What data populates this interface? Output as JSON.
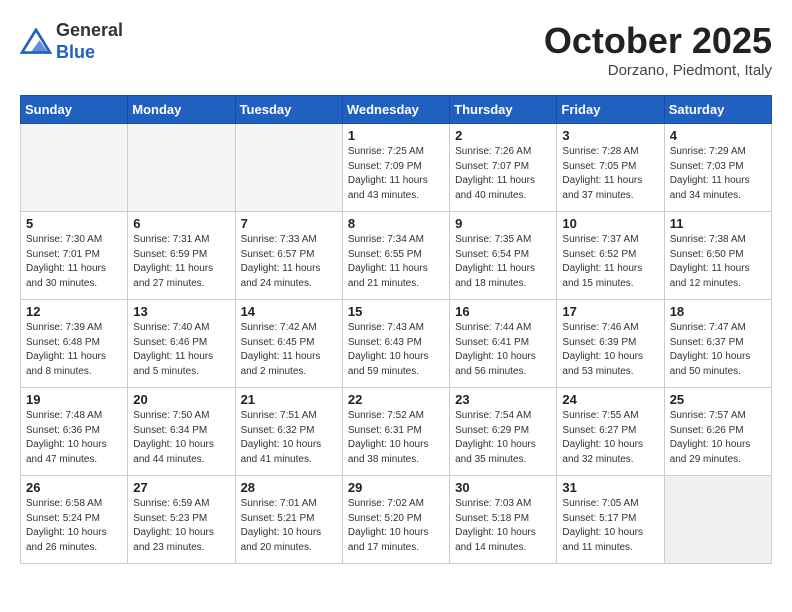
{
  "header": {
    "logo_line1": "General",
    "logo_line2": "Blue",
    "month_title": "October 2025",
    "location": "Dorzano, Piedmont, Italy"
  },
  "days_of_week": [
    "Sunday",
    "Monday",
    "Tuesday",
    "Wednesday",
    "Thursday",
    "Friday",
    "Saturday"
  ],
  "weeks": [
    [
      {
        "day": "",
        "info": ""
      },
      {
        "day": "",
        "info": ""
      },
      {
        "day": "",
        "info": ""
      },
      {
        "day": "1",
        "info": "Sunrise: 7:25 AM\nSunset: 7:09 PM\nDaylight: 11 hours\nand 43 minutes."
      },
      {
        "day": "2",
        "info": "Sunrise: 7:26 AM\nSunset: 7:07 PM\nDaylight: 11 hours\nand 40 minutes."
      },
      {
        "day": "3",
        "info": "Sunrise: 7:28 AM\nSunset: 7:05 PM\nDaylight: 11 hours\nand 37 minutes."
      },
      {
        "day": "4",
        "info": "Sunrise: 7:29 AM\nSunset: 7:03 PM\nDaylight: 11 hours\nand 34 minutes."
      }
    ],
    [
      {
        "day": "5",
        "info": "Sunrise: 7:30 AM\nSunset: 7:01 PM\nDaylight: 11 hours\nand 30 minutes."
      },
      {
        "day": "6",
        "info": "Sunrise: 7:31 AM\nSunset: 6:59 PM\nDaylight: 11 hours\nand 27 minutes."
      },
      {
        "day": "7",
        "info": "Sunrise: 7:33 AM\nSunset: 6:57 PM\nDaylight: 11 hours\nand 24 minutes."
      },
      {
        "day": "8",
        "info": "Sunrise: 7:34 AM\nSunset: 6:55 PM\nDaylight: 11 hours\nand 21 minutes."
      },
      {
        "day": "9",
        "info": "Sunrise: 7:35 AM\nSunset: 6:54 PM\nDaylight: 11 hours\nand 18 minutes."
      },
      {
        "day": "10",
        "info": "Sunrise: 7:37 AM\nSunset: 6:52 PM\nDaylight: 11 hours\nand 15 minutes."
      },
      {
        "day": "11",
        "info": "Sunrise: 7:38 AM\nSunset: 6:50 PM\nDaylight: 11 hours\nand 12 minutes."
      }
    ],
    [
      {
        "day": "12",
        "info": "Sunrise: 7:39 AM\nSunset: 6:48 PM\nDaylight: 11 hours\nand 8 minutes."
      },
      {
        "day": "13",
        "info": "Sunrise: 7:40 AM\nSunset: 6:46 PM\nDaylight: 11 hours\nand 5 minutes."
      },
      {
        "day": "14",
        "info": "Sunrise: 7:42 AM\nSunset: 6:45 PM\nDaylight: 11 hours\nand 2 minutes."
      },
      {
        "day": "15",
        "info": "Sunrise: 7:43 AM\nSunset: 6:43 PM\nDaylight: 10 hours\nand 59 minutes."
      },
      {
        "day": "16",
        "info": "Sunrise: 7:44 AM\nSunset: 6:41 PM\nDaylight: 10 hours\nand 56 minutes."
      },
      {
        "day": "17",
        "info": "Sunrise: 7:46 AM\nSunset: 6:39 PM\nDaylight: 10 hours\nand 53 minutes."
      },
      {
        "day": "18",
        "info": "Sunrise: 7:47 AM\nSunset: 6:37 PM\nDaylight: 10 hours\nand 50 minutes."
      }
    ],
    [
      {
        "day": "19",
        "info": "Sunrise: 7:48 AM\nSunset: 6:36 PM\nDaylight: 10 hours\nand 47 minutes."
      },
      {
        "day": "20",
        "info": "Sunrise: 7:50 AM\nSunset: 6:34 PM\nDaylight: 10 hours\nand 44 minutes."
      },
      {
        "day": "21",
        "info": "Sunrise: 7:51 AM\nSunset: 6:32 PM\nDaylight: 10 hours\nand 41 minutes."
      },
      {
        "day": "22",
        "info": "Sunrise: 7:52 AM\nSunset: 6:31 PM\nDaylight: 10 hours\nand 38 minutes."
      },
      {
        "day": "23",
        "info": "Sunrise: 7:54 AM\nSunset: 6:29 PM\nDaylight: 10 hours\nand 35 minutes."
      },
      {
        "day": "24",
        "info": "Sunrise: 7:55 AM\nSunset: 6:27 PM\nDaylight: 10 hours\nand 32 minutes."
      },
      {
        "day": "25",
        "info": "Sunrise: 7:57 AM\nSunset: 6:26 PM\nDaylight: 10 hours\nand 29 minutes."
      }
    ],
    [
      {
        "day": "26",
        "info": "Sunrise: 6:58 AM\nSunset: 5:24 PM\nDaylight: 10 hours\nand 26 minutes."
      },
      {
        "day": "27",
        "info": "Sunrise: 6:59 AM\nSunset: 5:23 PM\nDaylight: 10 hours\nand 23 minutes."
      },
      {
        "day": "28",
        "info": "Sunrise: 7:01 AM\nSunset: 5:21 PM\nDaylight: 10 hours\nand 20 minutes."
      },
      {
        "day": "29",
        "info": "Sunrise: 7:02 AM\nSunset: 5:20 PM\nDaylight: 10 hours\nand 17 minutes."
      },
      {
        "day": "30",
        "info": "Sunrise: 7:03 AM\nSunset: 5:18 PM\nDaylight: 10 hours\nand 14 minutes."
      },
      {
        "day": "31",
        "info": "Sunrise: 7:05 AM\nSunset: 5:17 PM\nDaylight: 10 hours\nand 11 minutes."
      },
      {
        "day": "",
        "info": ""
      }
    ]
  ]
}
